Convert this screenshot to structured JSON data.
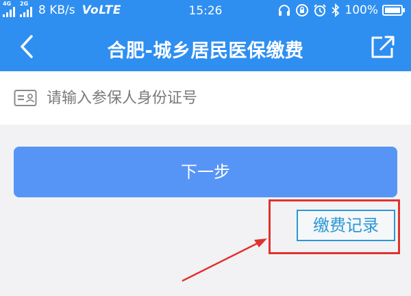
{
  "status_bar": {
    "signal1_tag": "4G",
    "signal2_tag": "2G",
    "net_speed": "8 KB/s",
    "volte": "VoLTE",
    "time": "15:26",
    "battery_percent": "100%",
    "icons": [
      "headset-icon",
      "rotation-lock-icon",
      "alarm-icon",
      "bluetooth-icon",
      "battery-icon"
    ]
  },
  "nav": {
    "title": "合肥-城乡居民医保缴费",
    "back_icon": "chevron-left-icon",
    "share_icon": "share-icon"
  },
  "form": {
    "id_placeholder": "请输入参保人身份证号",
    "id_value": "",
    "id_icon": "id-card-icon",
    "next_label": "下一步"
  },
  "records": {
    "label": "缴费记录"
  },
  "colors": {
    "header_blue": "#2f8ff0",
    "button_blue": "#5695f5",
    "records_blue": "#2b97d8",
    "annotation_red": "#e0322c",
    "background": "#f2f2f4"
  }
}
